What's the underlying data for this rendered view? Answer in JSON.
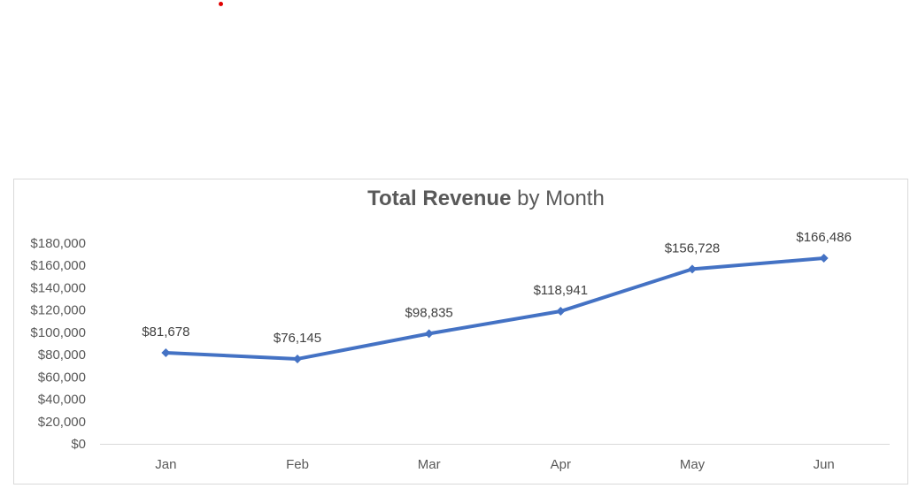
{
  "chart_data": {
    "type": "line",
    "title_bold": "Total Revenue",
    "title_rest": " by Month",
    "categories": [
      "Jan",
      "Feb",
      "Mar",
      "Apr",
      "May",
      "Jun"
    ],
    "values": [
      81678,
      76145,
      98835,
      118941,
      156728,
      166486
    ],
    "data_labels": [
      "$81,678",
      "$76,145",
      "$98,835",
      "$118,941",
      "$156,728",
      "$166,486"
    ],
    "y_ticks": [
      {
        "value": 0,
        "label": "$0"
      },
      {
        "value": 20000,
        "label": "$20,000"
      },
      {
        "value": 40000,
        "label": "$40,000"
      },
      {
        "value": 60000,
        "label": "$60,000"
      },
      {
        "value": 80000,
        "label": "$80,000"
      },
      {
        "value": 100000,
        "label": "$100,000"
      },
      {
        "value": 120000,
        "label": "$120,000"
      },
      {
        "value": 140000,
        "label": "$140,000"
      },
      {
        "value": 160000,
        "label": "$160,000"
      },
      {
        "value": 180000,
        "label": "$180,000"
      }
    ],
    "ylim": [
      0,
      180000
    ],
    "grid": false,
    "legend": "none",
    "line_color": "#4472c4"
  }
}
